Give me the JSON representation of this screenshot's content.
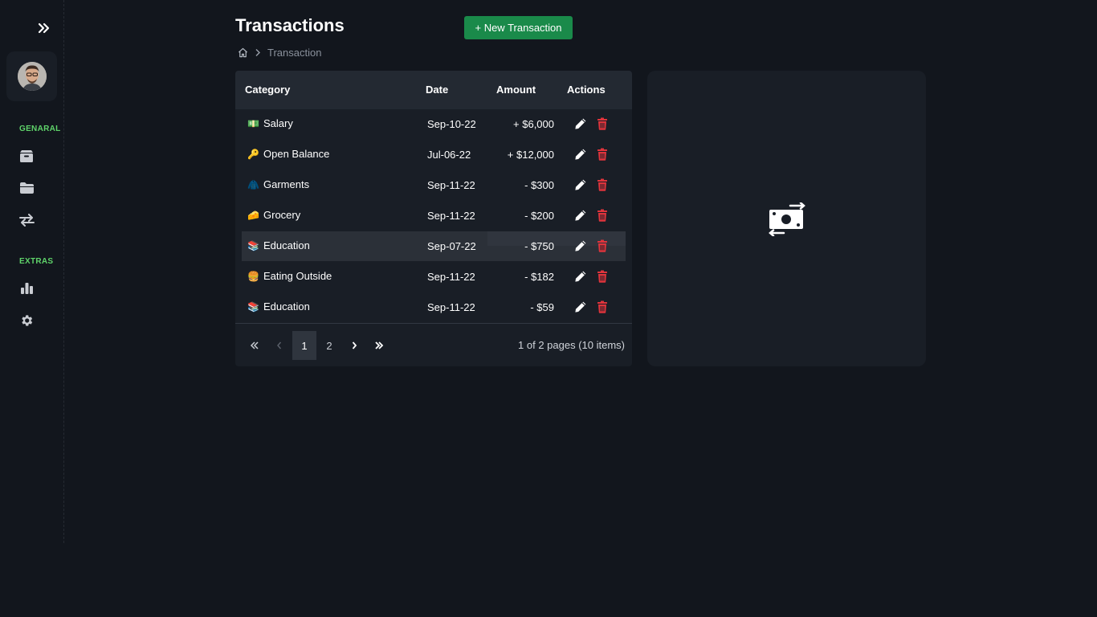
{
  "page": {
    "title": "Transactions",
    "new_button_label": "+ New Transaction",
    "breadcrumb_current": "Transaction"
  },
  "sidebar": {
    "sections": [
      {
        "label": "GENARAL",
        "icons": [
          "box-icon",
          "folder-icon",
          "transfer-icon"
        ]
      },
      {
        "label": "EXTRAS",
        "icons": [
          "bar-chart-icon",
          "settings-gear-icon"
        ]
      }
    ]
  },
  "table": {
    "headers": {
      "category": "Category",
      "date": "Date",
      "amount": "Amount",
      "actions": "Actions"
    },
    "rows": [
      {
        "emoji": "💵",
        "category": "Salary",
        "date": "Sep-10-22",
        "amount": "+ $6,000"
      },
      {
        "emoji": "🔑",
        "category": "Open Balance",
        "date": "Jul-06-22",
        "amount": "+ $12,000"
      },
      {
        "emoji": "🧥",
        "category": "Garments",
        "date": "Sep-11-22",
        "amount": "- $300"
      },
      {
        "emoji": "🧀",
        "category": "Grocery",
        "date": "Sep-11-22",
        "amount": "- $200"
      },
      {
        "emoji": "📚",
        "category": "Education",
        "date": "Sep-07-22",
        "amount": "- $750"
      },
      {
        "emoji": "🍔",
        "category": "Eating Outside",
        "date": "Sep-11-22",
        "amount": "- $182"
      },
      {
        "emoji": "📚",
        "category": "Education",
        "date": "Sep-11-22",
        "amount": "- $59"
      }
    ],
    "hovered_row_index": 4
  },
  "pagination": {
    "pages": [
      "1",
      "2"
    ],
    "current_page": "1",
    "info": "1 of 2 pages (10 items)"
  },
  "colors": {
    "background": "#12161d",
    "card": "#191e26",
    "accent_green": "#1a8a4a",
    "section_label": "#5fd36a",
    "delete_red": "#e0343c"
  }
}
